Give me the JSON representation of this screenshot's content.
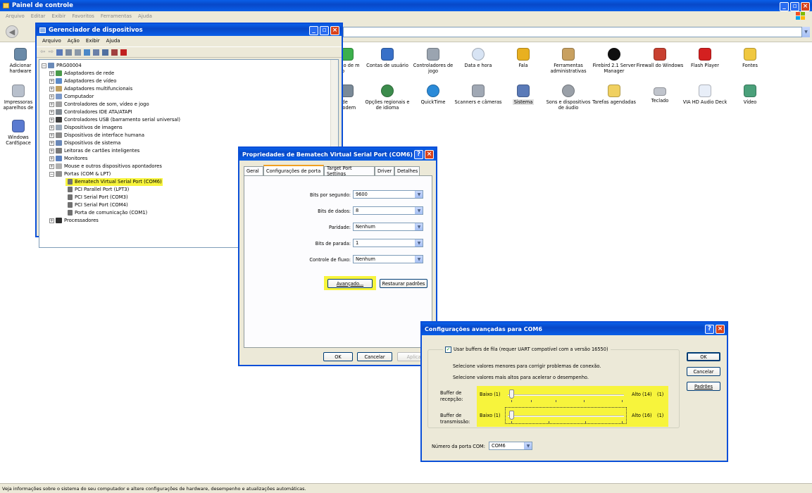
{
  "control_panel": {
    "title": "Painel de controle",
    "menu": [
      "Arquivo",
      "Editar",
      "Exibir",
      "Favoritos",
      "Ferramentas",
      "Ajuda"
    ],
    "icons_row1": [
      "Adicionar hardware",
      "ção de m Fio",
      "Contas de usuário",
      "Controladores de jogo",
      "Data e hora",
      "Fala",
      "Ferramentas administrativas",
      "Firebird 2.1 Server Manager",
      "Firewall do Windows",
      "Flash Player",
      "Fontes"
    ],
    "icons_row2": [
      "Impressoras aparelhos de",
      "s de modem",
      "Opções regionais e de idioma",
      "QuickTime",
      "Scanners e câmeras",
      "Sistema",
      "Sons e dispositivos de áudio",
      "Tarefas agendadas",
      "Teclado",
      "VIA HD Audio Deck",
      "Vídeo"
    ],
    "icons_row3": [
      "Windows CardSpace"
    ],
    "status": "Veja informações sobre o sistema do seu computador e altere configurações de hardware, desempenho e atualizações automáticas."
  },
  "device_manager": {
    "title": "Gerenciador de dispositivos",
    "menu": [
      "Arquivo",
      "Ação",
      "Exibir",
      "Ajuda"
    ],
    "root": "PRG00004",
    "items": [
      "Adaptadores de rede",
      "Adaptadores de vídeo",
      "Adaptadores multifuncionais",
      "Computador",
      "Controladores de som, vídeo e jogo",
      "Controladores IDE ATA/ATAPI",
      "Controladores USB (barramento serial universal)",
      "Dispositivos de imagens",
      "Dispositivos de interface humana",
      "Dispositivos de sistema",
      "Leitoras de cartões inteligentes",
      "Monitores",
      "Mouse e outros dispositivos apontadores",
      "Portas (COM & LPT)"
    ],
    "ports": [
      "Bematech Virtual Serial Port (COM6)",
      "PCI Parallel Port (LPT3)",
      "PCI Serial Port (COM3)",
      "PCI Serial Port (COM4)",
      "Porta de comunicação (COM1)"
    ],
    "last": "Processadores"
  },
  "properties": {
    "title": "Propriedades de Bematech Virtual Serial Port (COM6)",
    "tabs": [
      "Geral",
      "Configurações de porta",
      "Target Port Settings",
      "Driver",
      "Detalhes"
    ],
    "fields": [
      {
        "label": "Bits por segundo:",
        "value": "9600"
      },
      {
        "label": "Bits de dados:",
        "value": "8"
      },
      {
        "label": "Paridade:",
        "value": "Nenhum"
      },
      {
        "label": "Bits de parada:",
        "value": "1"
      },
      {
        "label": "Controle de fluxo:",
        "value": "Nenhum"
      }
    ],
    "advanced": "Avançado...",
    "restore": "Restaurar padrões",
    "ok": "OK",
    "cancel": "Cancelar",
    "apply": "Aplicar"
  },
  "advanced": {
    "title": "Configurações avançadas para COM6",
    "use_fifo": "Usar buffers de fila (requer UART compatível com a versão 16550)",
    "hint1": "Selecione valores menores para corrigir problemas de conexão.",
    "hint2": "Selecione valores mais altos para acelerar o desempenho.",
    "rx_label": "Buffer de recepção:",
    "rx_low": "Baixo (1)",
    "rx_high": "Alto (14)",
    "rx_value": "(1)",
    "tx_label": "Buffer de transmissão:",
    "tx_low": "Baixo (1)",
    "tx_high": "Alto (16)",
    "tx_value": "(1)",
    "com_label": "Número da porta COM:",
    "com_value": "COM6",
    "ok": "OK",
    "cancel": "Cancelar",
    "defaults": "Padrões"
  },
  "colors": {
    "title_blue": "#0a5fe8",
    "highlight": "#f7f43c",
    "xp_bg": "#ece9d8"
  }
}
